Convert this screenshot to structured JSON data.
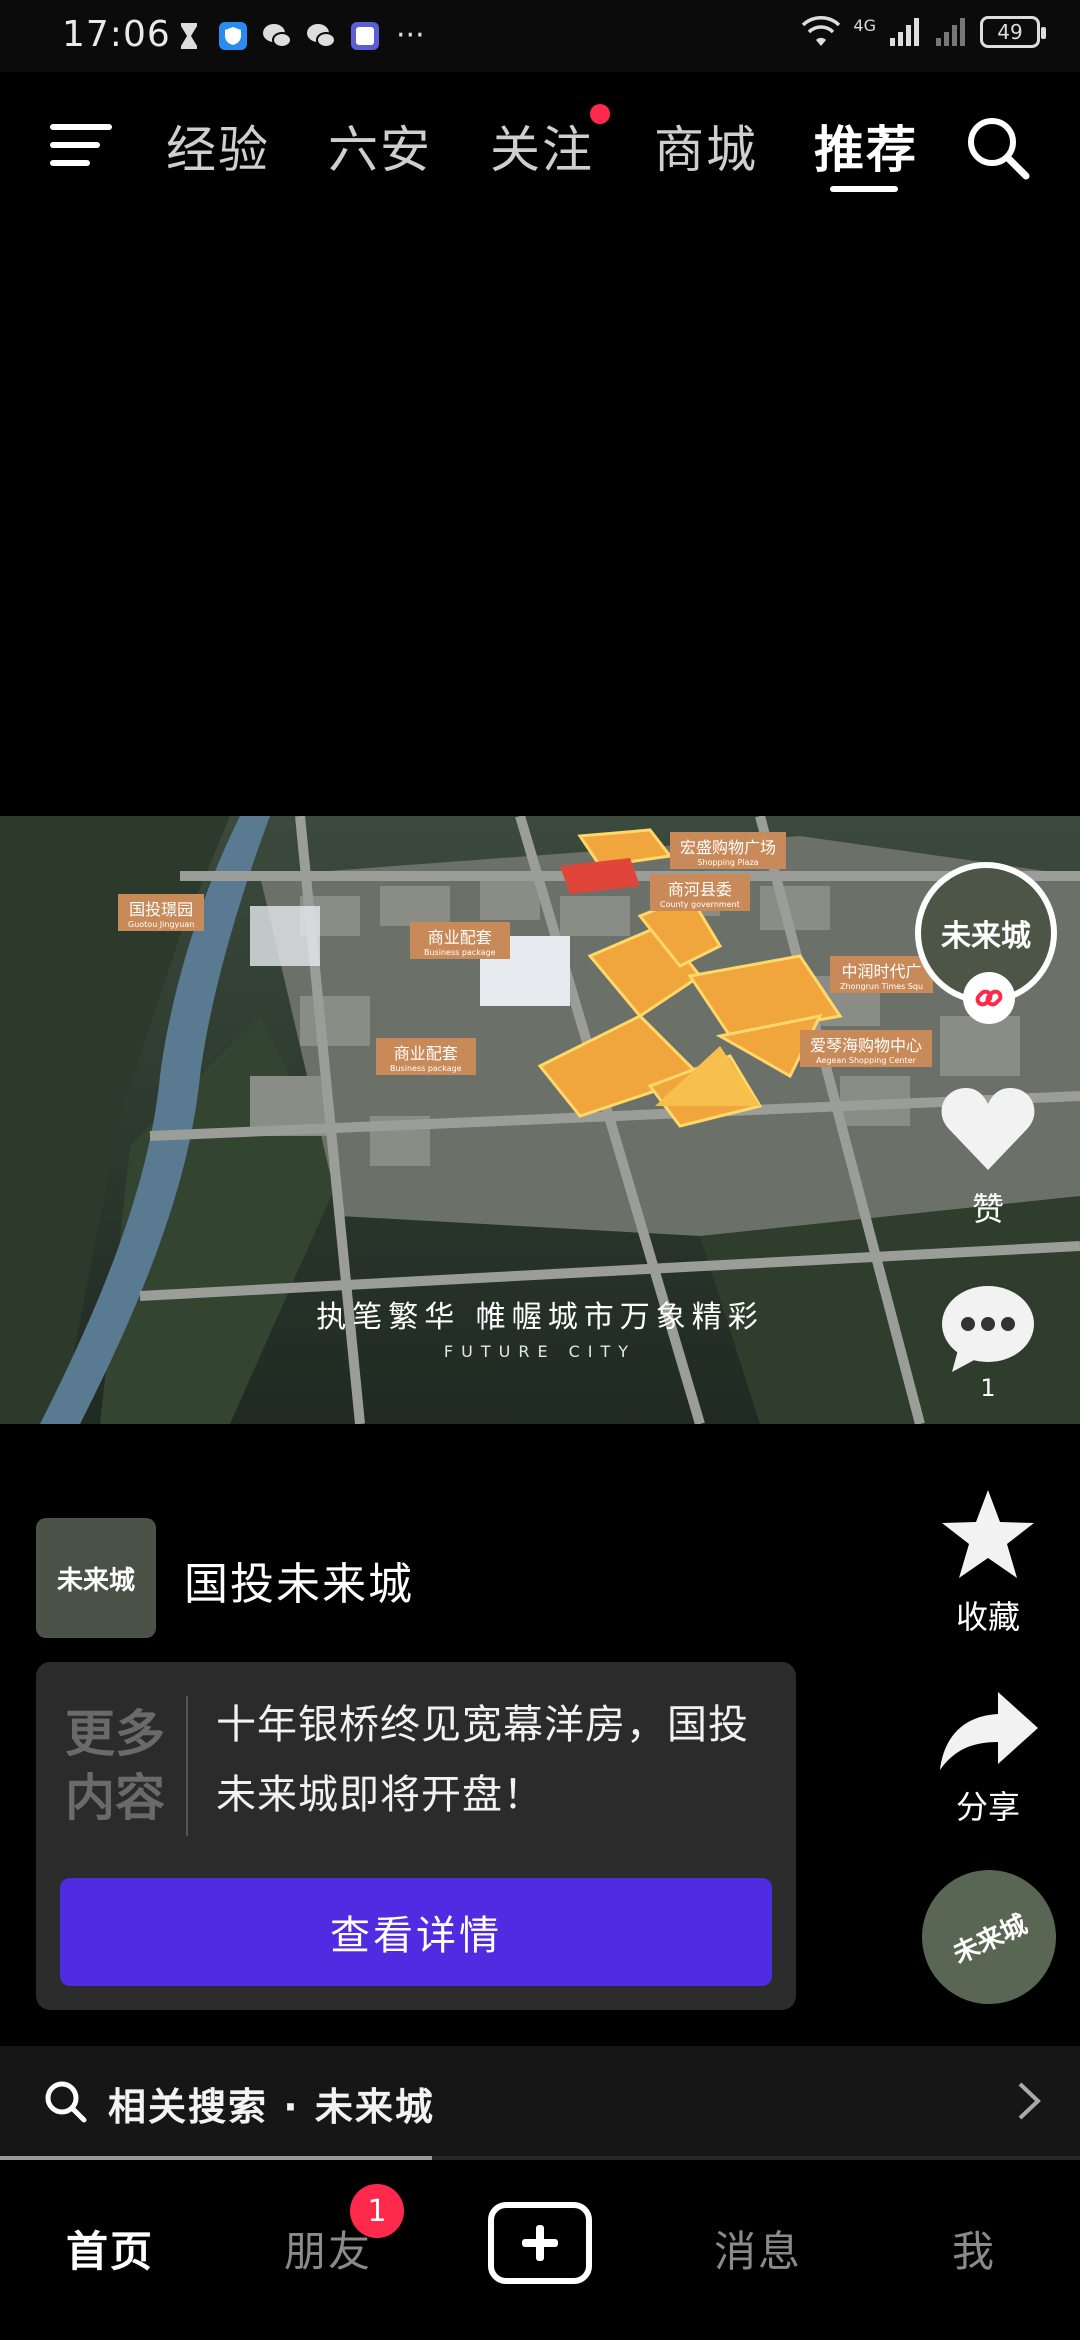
{
  "status_bar": {
    "time": "17:06",
    "network": "4G",
    "battery": "49"
  },
  "top_nav": {
    "tabs": [
      "经验",
      "六安",
      "关注",
      "商城",
      "推荐"
    ],
    "active_tab": "推荐"
  },
  "video": {
    "overlay_title": "执笔繁华 帷幄城市万象精彩",
    "overlay_subtitle": "FUTURE CITY",
    "map_labels": [
      {
        "cn": "国投璟园",
        "en": "Guotou Jingyuan"
      },
      {
        "cn": "商业配套",
        "en": "Business package"
      },
      {
        "cn": "宏盛购物广场",
        "en": "Shopping Plaza"
      },
      {
        "cn": "商河县委",
        "en": "County government"
      },
      {
        "cn": "中润时代广",
        "en": "Zhongrun Times Squ"
      },
      {
        "cn": "商业配套",
        "en": "Business package"
      },
      {
        "cn": "爱琴海购物中心",
        "en": "Aegean Shopping Center"
      }
    ]
  },
  "rail": {
    "avatar_text": "未来城",
    "like_label": "赞",
    "comment_count": "1",
    "collect_label": "收藏",
    "share_label": "分享",
    "disc_text": "未来城"
  },
  "account": {
    "avatar_text": "未来城",
    "name": "国投未来城"
  },
  "promo": {
    "more_label": "更多内容",
    "text": "十年银桥终见宽幕洋房，国投未来城即将开盘！",
    "button": "查看详情"
  },
  "related_search": {
    "text": "相关搜索 · 未来城",
    "progress_fraction": 0.4
  },
  "bottom_nav": {
    "items": [
      "首页",
      "朋友",
      "消息",
      "我"
    ],
    "friends_badge": "1"
  },
  "colors": {
    "accent_purple": "#4f2be2",
    "badge_red": "#ff2a4b"
  }
}
